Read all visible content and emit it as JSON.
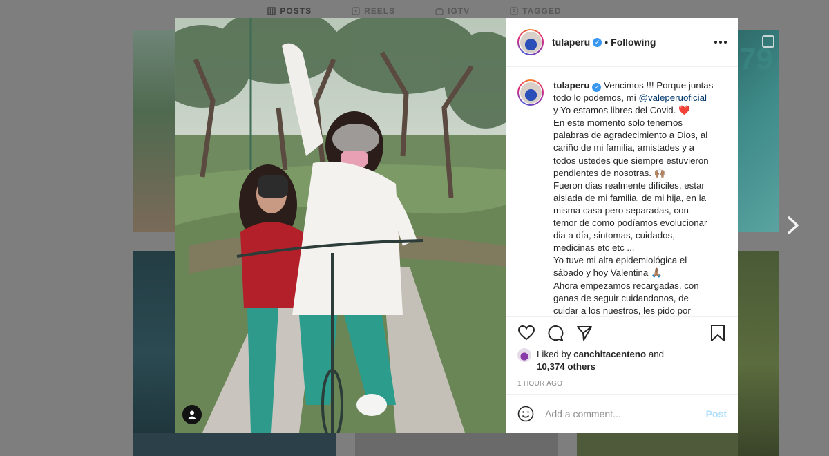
{
  "profile_tabs": [
    {
      "label": "POSTS",
      "icon": "grid-icon"
    },
    {
      "label": "REELS",
      "icon": "reels-icon"
    },
    {
      "label": "IGTV",
      "icon": "igtv-icon"
    },
    {
      "label": "TAGGED",
      "icon": "tagged-icon"
    }
  ],
  "background_tile_text": "79",
  "post": {
    "username": "tulaperu",
    "follow_status": "Following",
    "caption_lines": [
      "Vencimos !!! Porque juntas",
      "todo lo podemos, mi",
      "y Yo estamos libres del Covid.",
      "En este momento solo tenemos",
      "palabras de agradecimiento a Dios, al",
      "cariño de mi familia, amistades y a",
      "todos ustedes que siempre estuvieron",
      "pendientes de nosotras.",
      "Fueron días realmente difíciles, estar",
      "aislada de mi familia, de mi hija, en la",
      "misma casa pero separadas, con",
      "temor de como podíamos evolucionar",
      "dia a día, sintomas, cuidados,",
      "medicinas etc etc ...",
      "Yo tuve mi alta epidemiológica el",
      "sábado y hoy Valentina",
      "Ahora empezamos recargadas, con",
      "ganas de seguir cuidandonos, de",
      "cuidar a los nuestros, les pido por"
    ],
    "mention": "@valeperuoficial",
    "emoji_heart": "❤️",
    "emoji_hands": "🙌🏽",
    "emoji_pray": "🙏🏽",
    "liked_by_prefix": "Liked by",
    "liked_by_user": "canchitacenteno",
    "liked_by_and": "and",
    "others_count": "10,374 others",
    "time_ago": "1 HOUR AGO",
    "comment_placeholder": "Add a comment...",
    "post_button": "Post"
  },
  "colors": {
    "verified": "#3897f0",
    "mention": "#00376b",
    "post_disabled": "#b2dffc",
    "overlay": "#7e7e7e"
  }
}
